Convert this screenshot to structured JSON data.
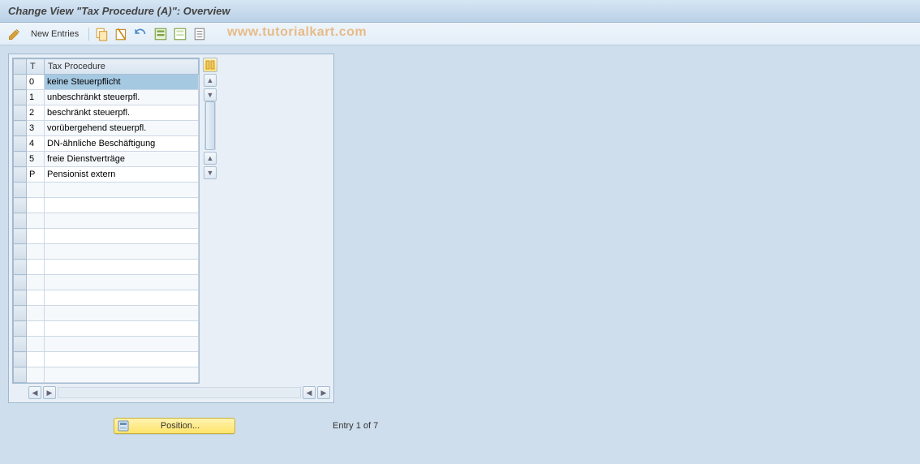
{
  "title": "Change View \"Tax Procedure (A)\": Overview",
  "toolbar": {
    "new_entries_label": "New Entries"
  },
  "watermark": "www.tutorialkart.com",
  "table": {
    "columns": {
      "t": "T",
      "procedure": "Tax Procedure"
    },
    "empty_rows": 13,
    "rows": [
      {
        "t": "0",
        "procedure": "keine Steuerpflicht",
        "selected": true
      },
      {
        "t": "1",
        "procedure": "unbeschränkt steuerpfl."
      },
      {
        "t": "2",
        "procedure": "beschränkt steuerpfl."
      },
      {
        "t": "3",
        "procedure": "vorübergehend steuerpfl."
      },
      {
        "t": "4",
        "procedure": "DN-ähnliche Beschäftigung"
      },
      {
        "t": "5",
        "procedure": "freie Dienstverträge"
      },
      {
        "t": "P",
        "procedure": "Pensionist extern"
      }
    ]
  },
  "footer": {
    "position_label": "Position...",
    "entry_text": "Entry 1 of 7"
  }
}
